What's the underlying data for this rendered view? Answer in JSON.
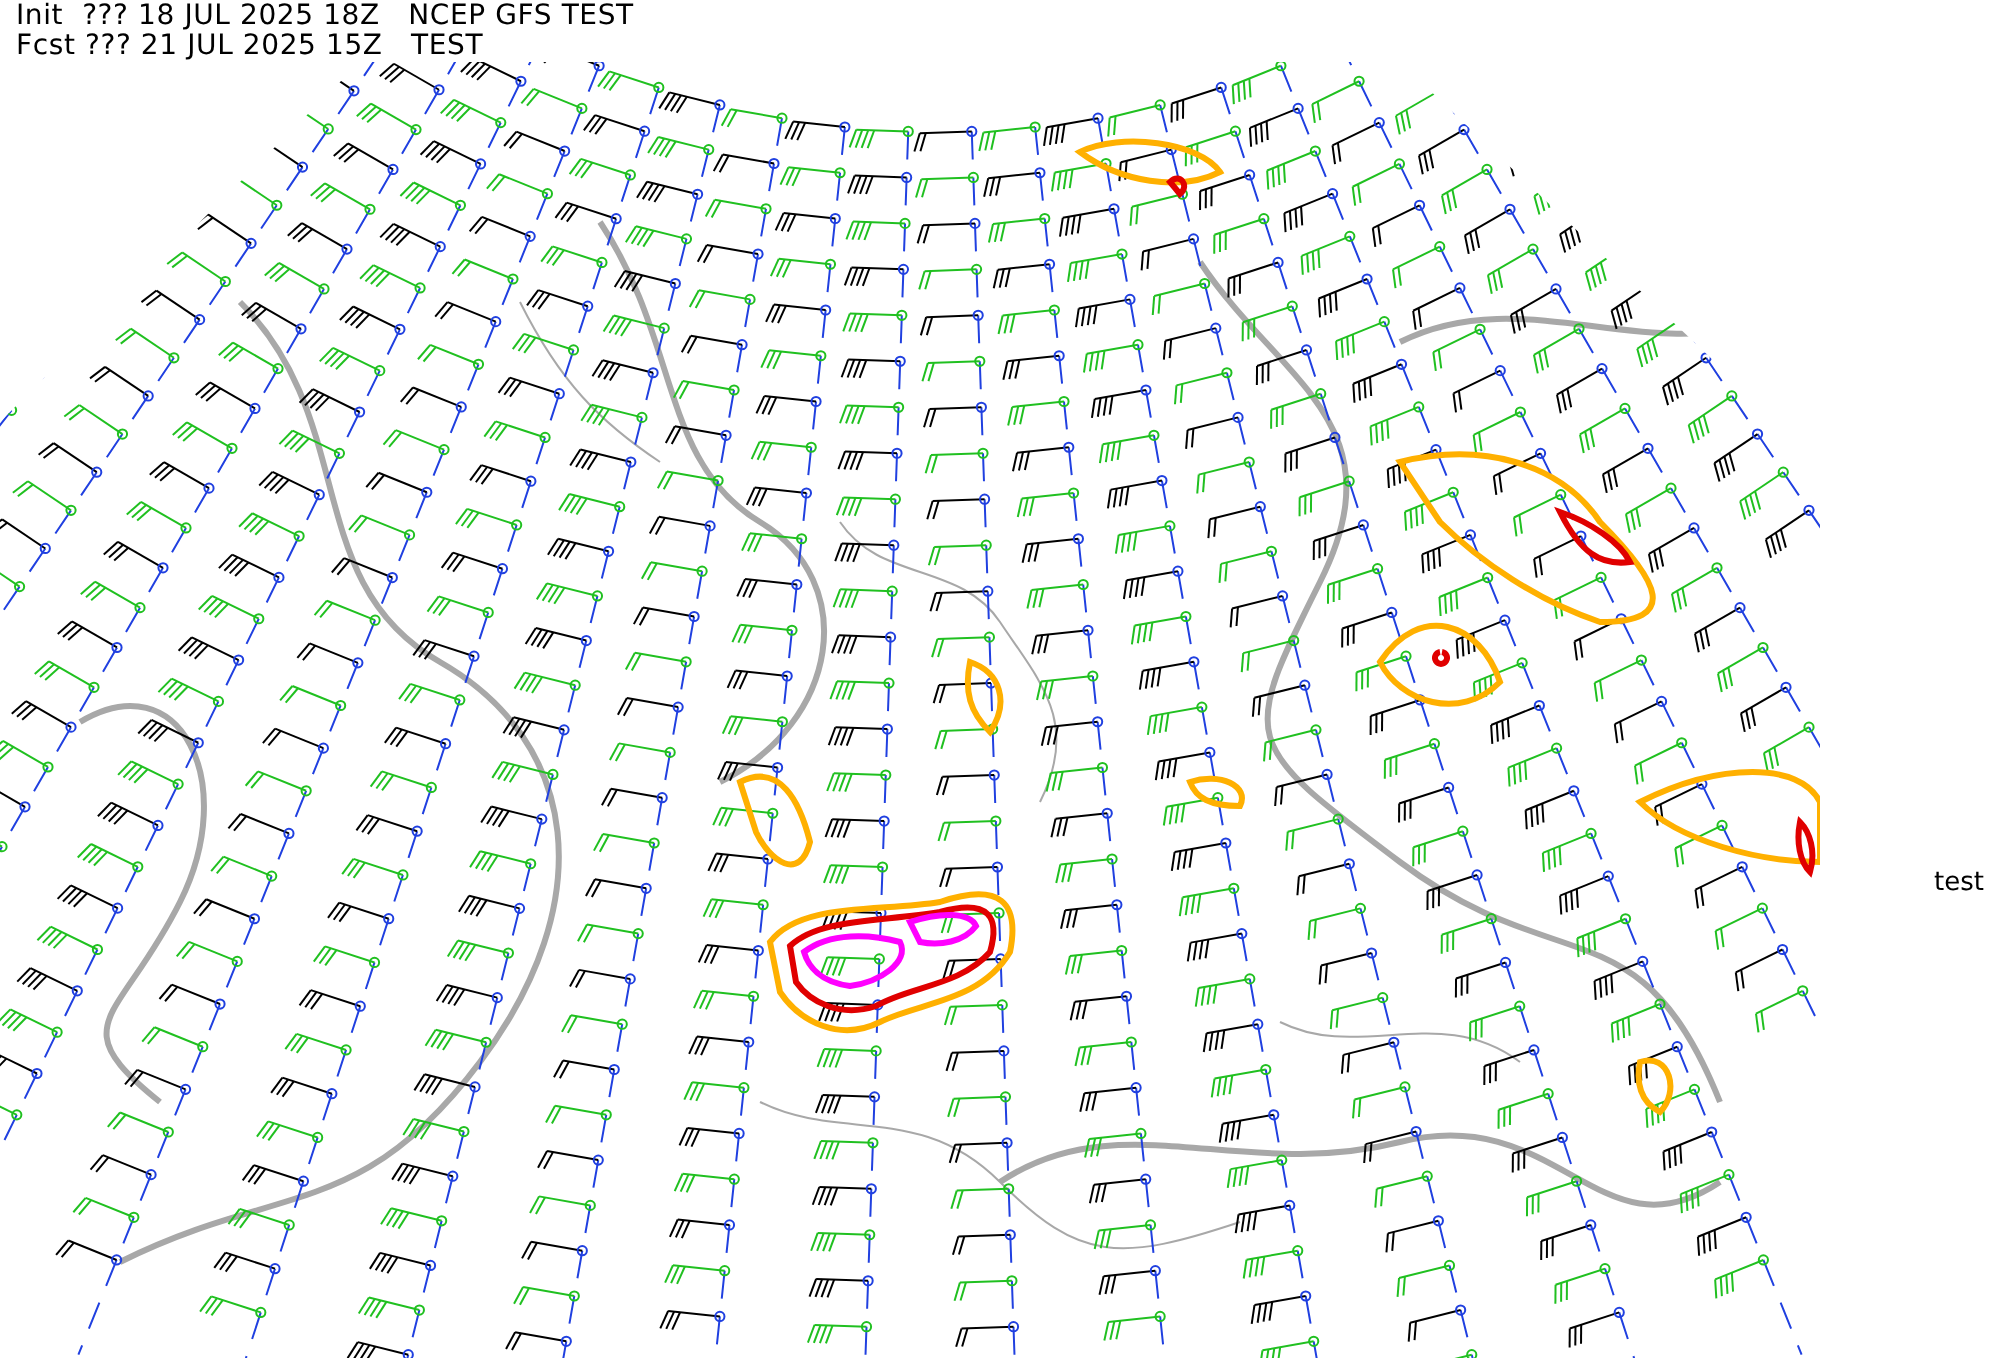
{
  "header": {
    "init_line": "Init  ??? 18 JUL 2025 18Z   NCEP GFS TEST",
    "forecast_line": "Fcst ??? 21 JUL 2025 15Z   TEST"
  },
  "side_label": "test"
}
